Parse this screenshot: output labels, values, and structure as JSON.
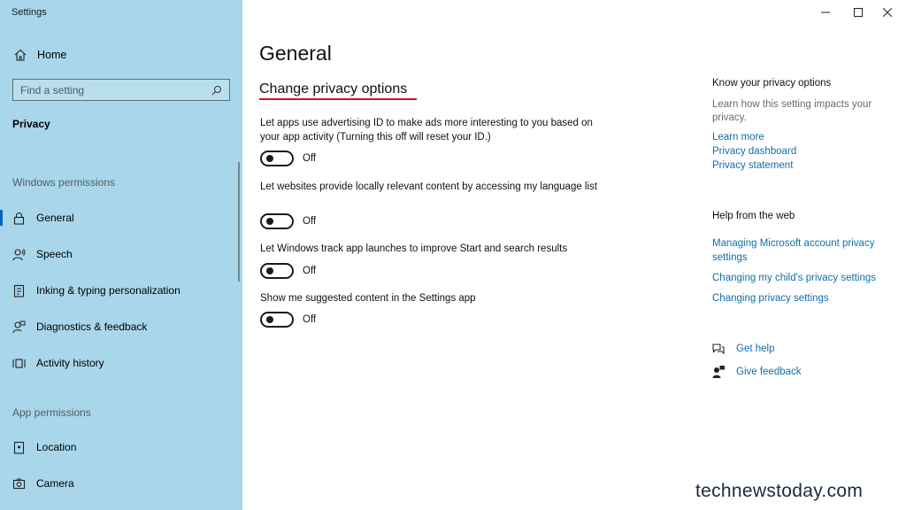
{
  "window": {
    "title": "Settings",
    "controls": {
      "minimize": "minimize-icon",
      "maximize": "maximize-icon",
      "close": "close-icon"
    }
  },
  "sidebar": {
    "home_label": "Home",
    "search_placeholder": "Find a setting",
    "section_title": "Privacy",
    "windows_permissions_label": "Windows permissions",
    "windows_items": [
      {
        "label": "General",
        "icon": "lock-icon",
        "active": true
      },
      {
        "label": "Speech",
        "icon": "speech-icon"
      },
      {
        "label": "Inking & typing personalization",
        "icon": "inking-icon"
      },
      {
        "label": "Diagnostics & feedback",
        "icon": "diagnostics-icon"
      },
      {
        "label": "Activity history",
        "icon": "activity-history-icon"
      }
    ],
    "app_permissions_label": "App permissions",
    "app_items": [
      {
        "label": "Location",
        "icon": "location-icon"
      },
      {
        "label": "Camera",
        "icon": "camera-icon"
      }
    ]
  },
  "main": {
    "page_title": "General",
    "subtitle": "Change privacy options",
    "settings": [
      {
        "description": "Let apps use advertising ID to make ads more interesting to you based on your app activity (Turning this off will reset your ID.)",
        "state": "Off"
      },
      {
        "description": "Let websites provide locally relevant content by accessing my language list",
        "state": "Off"
      },
      {
        "description": "Let Windows track app launches to improve Start and search results",
        "state": "Off"
      },
      {
        "description": "Show me suggested content in the Settings app",
        "state": "Off"
      }
    ]
  },
  "right": {
    "know_heading": "Know your privacy options",
    "know_text": "Learn how this setting impacts your privacy.",
    "know_links": [
      "Learn more",
      "Privacy dashboard",
      "Privacy statement"
    ],
    "help_heading": "Help from the web",
    "help_links": [
      "Managing Microsoft account privacy settings",
      "Changing my child's privacy settings",
      "Changing privacy settings"
    ],
    "get_help": "Get help",
    "give_feedback": "Give feedback"
  },
  "watermark": "technewstoday.com",
  "colors": {
    "sidebar_bg": "#a9d6ea",
    "accent": "#0067b8",
    "link": "#0f6fa8",
    "underline": "#d41414"
  }
}
